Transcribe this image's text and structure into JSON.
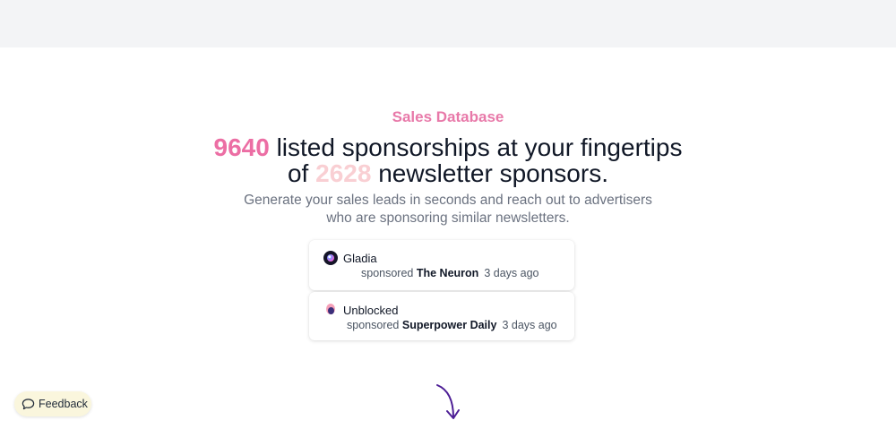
{
  "section": {
    "label": "Sales Database"
  },
  "headline": {
    "listed_count": "9640",
    "line1_rest": " listed sponsorships at your fingertips",
    "line2_prefix": "of ",
    "sponsor_count": "2628",
    "line2_rest": " newsletter sponsors."
  },
  "subtext": {
    "line1": "Generate your sales leads in seconds and reach out to advertisers",
    "line2": "who are sponsoring similar newsletters."
  },
  "sponsorships": [
    {
      "company": "Gladia",
      "verb": "sponsored",
      "newsletter": "The Neuron",
      "time": "3 days ago",
      "logo_icon": "gladia-logo"
    },
    {
      "company": "Unblocked",
      "verb": "sponsored",
      "newsletter": "Superpower Daily",
      "time": "3 days ago",
      "logo_icon": "unblocked-logo"
    }
  ],
  "feedback": {
    "label": "Feedback",
    "icon": "chat-bubble-icon"
  },
  "scroll_hint_icon": "curved-arrow-down-icon",
  "colors": {
    "accent_pink": "#e879a9",
    "count_pink": "#ec6ea4",
    "count_light_pink": "#f9cfd3",
    "arrow_purple": "#4c1d95",
    "feedback_bg": "#faf6dd"
  }
}
